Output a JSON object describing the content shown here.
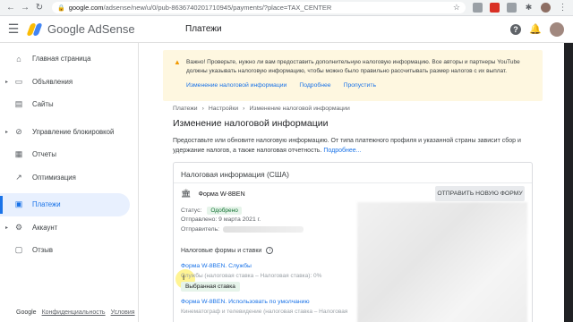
{
  "browser": {
    "url_host": "google.com",
    "url_path": "/adsense/new/u/0/pub-8636740201710945/payments/?place=TAX_CENTER"
  },
  "header": {
    "logo_text": "Google AdSense",
    "page_title": "Платежи"
  },
  "sidebar": {
    "items": [
      {
        "label": "Главная страница",
        "icon": "home-icon"
      },
      {
        "label": "Объявления",
        "icon": "ads-icon"
      },
      {
        "label": "Сайты",
        "icon": "sites-icon"
      },
      {
        "label": "Управление блокировкой",
        "icon": "block-icon"
      },
      {
        "label": "Отчеты",
        "icon": "reports-icon"
      },
      {
        "label": "Оптимизация",
        "icon": "optimization-icon"
      },
      {
        "label": "Платежи",
        "icon": "payments-icon"
      },
      {
        "label": "Аккаунт",
        "icon": "account-icon"
      },
      {
        "label": "Отзыв",
        "icon": "feedback-icon"
      }
    ],
    "footer": {
      "brand": "Google",
      "privacy": "Конфиденциальность",
      "terms": "Условия"
    }
  },
  "alert": {
    "text": "Важно! Проверьте, нужно ли вам предоставить дополнительную налоговую информацию. Все авторы и партнеры YouTube должны указывать налоговую информацию, чтобы можно было правильно рассчитывать размер налогов с их выплат.",
    "link_change": "Изменение налоговой информации",
    "link_more": "Подробнее",
    "link_skip": "Пропустить"
  },
  "breadcrumbs": [
    "Платежи",
    "Настройки",
    "Изменение налоговой информации"
  ],
  "main": {
    "title": "Изменение налоговой информации",
    "description": "Предоставьте или обновите налоговую информацию. От типа платежного профиля и указанной страны зависит сбор и удержание налогов, а также налоговая отчетность.",
    "description_link": "Подробнее..."
  },
  "card": {
    "title": "Налоговая информация (США)",
    "form_name": "Форма W-8BEN",
    "send_button": "ОТПРАВИТЬ НОВУЮ ФОРМУ",
    "status_label": "Статус:",
    "status_value": "Одобрено",
    "sent_text": "Отправлено: 9 марта 2021 г.",
    "sender_label": "Отправитель:",
    "forms_heading": "Налоговые формы и ставки",
    "form1_link": "Форма W-8BEN. Службы",
    "form1_rate": "Службы (налоговая ставка – Налоговая ставка): 0%",
    "chip": "Выбранная ставка",
    "form2_link": "Форма W-8BEN. Использовать по умолчанию",
    "form2_rate": "Кинематограф и телевидение (налоговая ставка – Налоговая"
  }
}
